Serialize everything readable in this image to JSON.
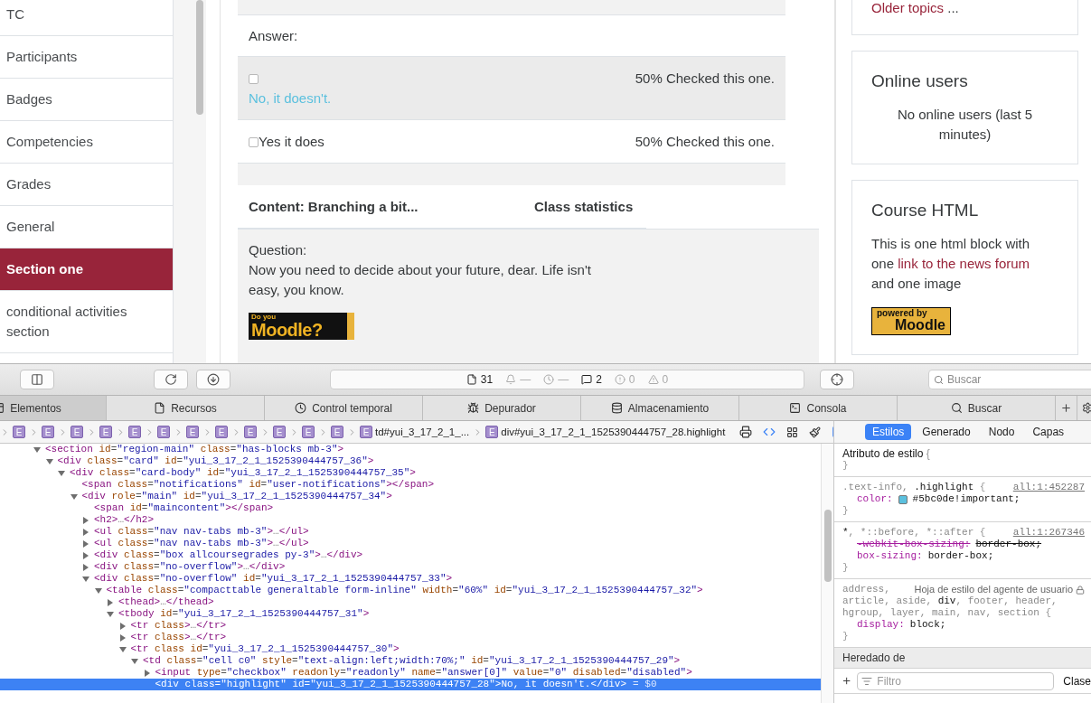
{
  "course_nav": {
    "items": [
      {
        "label": "TC",
        "selected": false
      },
      {
        "label": "Participants",
        "selected": false
      },
      {
        "label": "Badges",
        "selected": false
      },
      {
        "label": "Competencies",
        "selected": false
      },
      {
        "label": "Grades",
        "selected": false
      },
      {
        "label": "General",
        "selected": false
      },
      {
        "label": "Section one",
        "selected": true
      },
      {
        "label": "conditional activities section",
        "selected": false
      }
    ]
  },
  "answers": {
    "heading": "Answer:",
    "rows": [
      {
        "label": "No, it doesn't.",
        "checked": false,
        "highlighted": true,
        "stat": "50% Checked this one."
      },
      {
        "label": "Yes it does",
        "checked": false,
        "highlighted": false,
        "stat": "50% Checked this one."
      }
    ]
  },
  "content_headers": [
    "Content: Branching a bit...",
    "Class statistics"
  ],
  "question": {
    "label": "Question:",
    "text": "Now you need to decide about your future, dear. Life isn't easy, you know.",
    "logo": {
      "small": "Do you",
      "big": "Moodle?"
    }
  },
  "blocks": [
    {
      "kind": "links",
      "link": "Older topics",
      "suffix": "..."
    },
    {
      "kind": "online",
      "title": "Online users",
      "text": "No online users (last 5 minutes)"
    },
    {
      "kind": "html",
      "title": "Course HTML",
      "before": "This is one html block with one",
      "link": "link to the news forum",
      "after": "and one image",
      "badge": {
        "small": "powered by",
        "big": "Moodle"
      }
    }
  ],
  "devtools": {
    "toolbar": {
      "status": [
        {
          "kind": "resources",
          "text": "31",
          "dimmed": false
        },
        {
          "kind": "network",
          "text": "—",
          "dimmed": true
        },
        {
          "kind": "time",
          "text": "—",
          "dimmed": true
        },
        {
          "kind": "logs",
          "text": "2",
          "dimmed": false
        },
        {
          "kind": "errors",
          "text": "0",
          "dimmed": true
        },
        {
          "kind": "warnings",
          "text": "0",
          "dimmed": true
        }
      ],
      "search_placeholder": "Buscar"
    },
    "tabs": [
      {
        "kind": "elements",
        "label": "Elementos",
        "selected": true
      },
      {
        "kind": "resources",
        "label": "Recursos",
        "selected": false
      },
      {
        "kind": "timeline",
        "label": "Control temporal",
        "selected": false
      },
      {
        "kind": "debugger",
        "label": "Depurador",
        "selected": false
      },
      {
        "kind": "storage",
        "label": "Almacenamiento",
        "selected": false
      },
      {
        "kind": "console",
        "label": "Consola",
        "selected": false
      },
      {
        "kind": "search",
        "label": "Buscar",
        "selected": false
      }
    ],
    "breadcrumbs": [
      {
        "badge": "E"
      },
      {
        "badge": "E"
      },
      {
        "badge": "E"
      },
      {
        "badge": "E"
      },
      {
        "badge": "E"
      },
      {
        "badge": "E"
      },
      {
        "badge": "E"
      },
      {
        "badge": "E"
      },
      {
        "badge": "E"
      },
      {
        "badge": "E"
      },
      {
        "badge": "E"
      },
      {
        "badge": "E"
      },
      {
        "badge": "E",
        "label": "td#yui_3_17_2_1_..."
      },
      {
        "badge": "E",
        "label": "div#yui_3_17_2_1_1525390444757_28.highlight"
      }
    ],
    "dom_tree": [
      {
        "kind": "parent",
        "expanded": true,
        "selected": false,
        "text": "<section id=\"region-main\" class=\"has-blocks mb-3\">",
        "children": [
          {
            "kind": "parent",
            "expanded": true,
            "selected": false,
            "text": "<div class=\"card\" id=\"yui_3_17_2_1_1525390444757_36\">",
            "children": [
              {
                "kind": "parent",
                "expanded": true,
                "selected": false,
                "text": "<div class=\"card-body\" id=\"yui_3_17_2_1_1525390444757_35\">",
                "children": [
                  {
                    "kind": "leaf",
                    "selected": false,
                    "text": "<span class=\"notifications\" id=\"user-notifications\"></span>"
                  },
                  {
                    "kind": "parent",
                    "expanded": true,
                    "selected": false,
                    "text": "<div role=\"main\" id=\"yui_3_17_2_1_1525390444757_34\">",
                    "children": [
                      {
                        "kind": "leaf",
                        "selected": false,
                        "text": "<span id=\"maincontent\"></span>"
                      },
                      {
                        "kind": "parent",
                        "expanded": false,
                        "selected": false,
                        "text": "<h2>…</h2>"
                      },
                      {
                        "kind": "parent",
                        "expanded": false,
                        "selected": false,
                        "text": "<ul class=\"nav nav-tabs mb-3\">…</ul>"
                      },
                      {
                        "kind": "parent",
                        "expanded": false,
                        "selected": false,
                        "text": "<ul class=\"nav nav-tabs mb-3\">…</ul>"
                      },
                      {
                        "kind": "parent",
                        "expanded": false,
                        "selected": false,
                        "text": "<div class=\"box allcoursegrades py-3\">…</div>"
                      },
                      {
                        "kind": "parent",
                        "expanded": false,
                        "selected": false,
                        "text": "<div class=\"no-overflow\">…</div>"
                      },
                      {
                        "kind": "parent",
                        "expanded": true,
                        "selected": false,
                        "text": "<div class=\"no-overflow\" id=\"yui_3_17_2_1_1525390444757_33\">",
                        "children": [
                          {
                            "kind": "parent",
                            "expanded": true,
                            "selected": false,
                            "text": "<table class=\"compacttable generaltable form-inline\" width=\"60%\" id=\"yui_3_17_2_1_1525390444757_32\">",
                            "children": [
                              {
                                "kind": "parent",
                                "expanded": false,
                                "selected": false,
                                "text": "<thead>…</thead>"
                              },
                              {
                                "kind": "parent",
                                "expanded": true,
                                "selected": false,
                                "text": "<tbody id=\"yui_3_17_2_1_1525390444757_31\">",
                                "children": [
                                  {
                                    "kind": "parent",
                                    "expanded": false,
                                    "selected": false,
                                    "text": "<tr class>…</tr>"
                                  },
                                  {
                                    "kind": "parent",
                                    "expanded": false,
                                    "selected": false,
                                    "text": "<tr class>…</tr>"
                                  },
                                  {
                                    "kind": "parent",
                                    "expanded": true,
                                    "selected": false,
                                    "text": "<tr class id=\"yui_3_17_2_1_1525390444757_30\">",
                                    "children": [
                                      {
                                        "kind": "parent",
                                        "expanded": true,
                                        "selected": false,
                                        "text": "<td class=\"cell c0\" style=\"text-align:left;width:70%;\" id=\"yui_3_17_2_1_1525390444757_29\">",
                                        "children": [
                                          {
                                            "kind": "parent",
                                            "expanded": false,
                                            "selected": false,
                                            "text": "<input type=\"checkbox\" readonly=\"readonly\" name=\"answer[0]\" value=\"0\" disabled=\"disabled\">"
                                          },
                                          {
                                            "kind": "leaf",
                                            "selected": true,
                                            "text": "<div class=\"highlight\" id=\"yui_3_17_2_1_1525390444757_28\">No, it doesn't.</div>",
                                            "suffix": "= $0"
                                          }
                                        ]
                                      }
                                    ]
                                  }
                                ]
                              }
                            ]
                          }
                        ]
                      }
                    ]
                  }
                ]
              }
            ]
          }
        ]
      }
    ],
    "sidebar_tabs": [
      {
        "label": "Estilos",
        "selected": true
      },
      {
        "label": "Generado",
        "selected": false
      },
      {
        "label": "Nodo",
        "selected": false
      },
      {
        "label": "Capas",
        "selected": false
      }
    ],
    "styles": {
      "rules": [
        {
          "kind": "inline",
          "selector_lines": [
            [
              {
                "text": "Atributo de estilo",
                "matched": true
              }
            ]
          ],
          "open_brace": "{",
          "close_brace": "}"
        },
        {
          "kind": "author",
          "selector_lines": [
            [
              {
                "text": ".text-info, ",
                "matched": false
              },
              {
                "text": ".highlight",
                "matched": true
              }
            ]
          ],
          "open_brace": "{",
          "source": "all:1:452287",
          "declarations": [
            {
              "property": "color:",
              "value": "#5bc0de!important;",
              "kind": "color",
              "overridden": false
            }
          ],
          "close_brace": "}"
        },
        {
          "kind": "author",
          "selector_lines": [
            [
              {
                "text": "*",
                "matched": true
              },
              {
                "text": ", *::before, *::after",
                "matched": false
              }
            ]
          ],
          "open_brace": "{",
          "source": "all:1:267346",
          "declarations": [
            {
              "property": "-webkit-box-sizing:",
              "value": "border-box;",
              "overridden": true
            },
            {
              "property": "box-sizing:",
              "value": "border-box;",
              "overridden": false
            }
          ],
          "close_brace": "}"
        },
        {
          "kind": "agent",
          "selector_lines": [
            [
              {
                "text": "address,",
                "matched": false
              }
            ],
            [
              {
                "text": "article, aside, ",
                "matched": false
              },
              {
                "text": "div",
                "matched": true
              },
              {
                "text": ", footer, header,",
                "matched": false
              }
            ],
            [
              {
                "text": "hgroup, layer, main, nav, section",
                "matched": false
              }
            ]
          ],
          "open_brace": "{",
          "source": "Hoja de estilo del agente de usuario",
          "declarations": [
            {
              "property": "display:",
              "value": "block;",
              "overridden": false
            }
          ],
          "close_brace": "}"
        }
      ],
      "inherited_label": "Heredado de",
      "filter_placeholder": "Filtro",
      "class_button": "Clase"
    }
  }
}
